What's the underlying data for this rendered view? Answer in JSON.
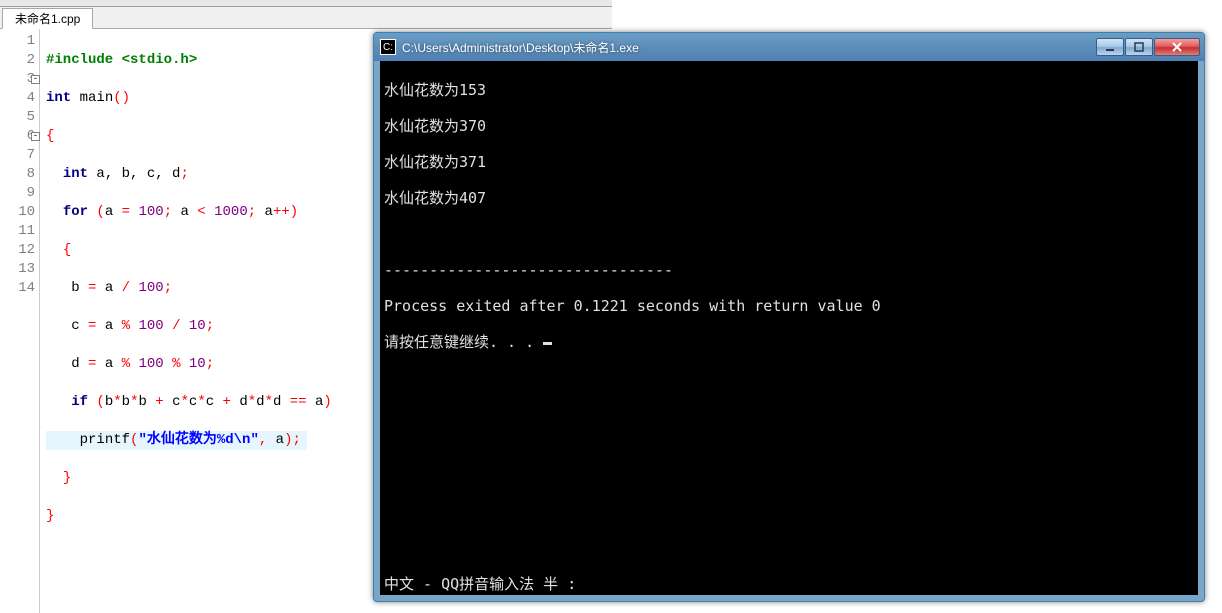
{
  "ide": {
    "tab_label": "未命名1.cpp",
    "line_numbers": [
      "1",
      "2",
      "3",
      "4",
      "5",
      "6",
      "7",
      "8",
      "9",
      "10",
      "11",
      "12",
      "13",
      "14"
    ],
    "fold_lines": [
      3,
      6
    ],
    "code": {
      "l1": {
        "directive": "#include",
        "header": "<stdio.h>"
      },
      "l2": {
        "kw1": "int",
        "id": "main",
        "paren_open": "(",
        "paren_close": ")"
      },
      "l4": {
        "kw": "int",
        "ids": " a, b, c, d",
        "semi": ";"
      },
      "l5": {
        "kw": "for",
        "open": " (",
        "a": "a",
        "eq": " = ",
        "n100": "100",
        "semi1": "; ",
        "a2": "a",
        "lt": " < ",
        "n1000": "1000",
        "semi2": "; ",
        "a3": "a",
        "inc": "++",
        "close": ")"
      },
      "l7": {
        "b": "b",
        "eq": " = ",
        "a": "a",
        "div": " / ",
        "n": "100",
        "semi": ";"
      },
      "l8": {
        "c": "c",
        "eq": " = ",
        "a": "a",
        "mod": " % ",
        "n1": "100",
        "div": " / ",
        "n2": "10",
        "semi": ";"
      },
      "l9": {
        "d": "d",
        "eq": " = ",
        "a": "a",
        "mod1": " % ",
        "n1": "100",
        "mod2": " % ",
        "n2": "10",
        "semi": ";"
      },
      "l10": {
        "kw": "if",
        "open": " (",
        "expr1a": "b",
        "m1": "*",
        "expr1b": "b",
        "m2": "*",
        "expr1c": "b",
        "p1": " + ",
        "expr2a": "c",
        "m3": "*",
        "expr2b": "c",
        "m4": "*",
        "expr2c": "c",
        "p2": " + ",
        "expr3a": "d",
        "m5": "*",
        "expr3b": "d",
        "m6": "*",
        "expr3c": "d",
        "eqeq": " == ",
        "a": "a",
        "close": ")"
      },
      "l11": {
        "fn": "printf",
        "open": "(",
        "str": "\"水仙花数为%d\\n\"",
        "comma": ", ",
        "arg": "a",
        "close": ");"
      }
    }
  },
  "console": {
    "title": "C:\\Users\\Administrator\\Desktop\\未命名1.exe",
    "output": {
      "l1": "水仙花数为153",
      "l2": "水仙花数为370",
      "l3": "水仙花数为371",
      "l4": "水仙花数为407",
      "sep": "--------------------------------",
      "proc": "Process exited after 0.1221 seconds with return value 0",
      "prompt": "请按任意键继续. . . "
    },
    "ime": "中文 - QQ拼音输入法 半 :"
  }
}
